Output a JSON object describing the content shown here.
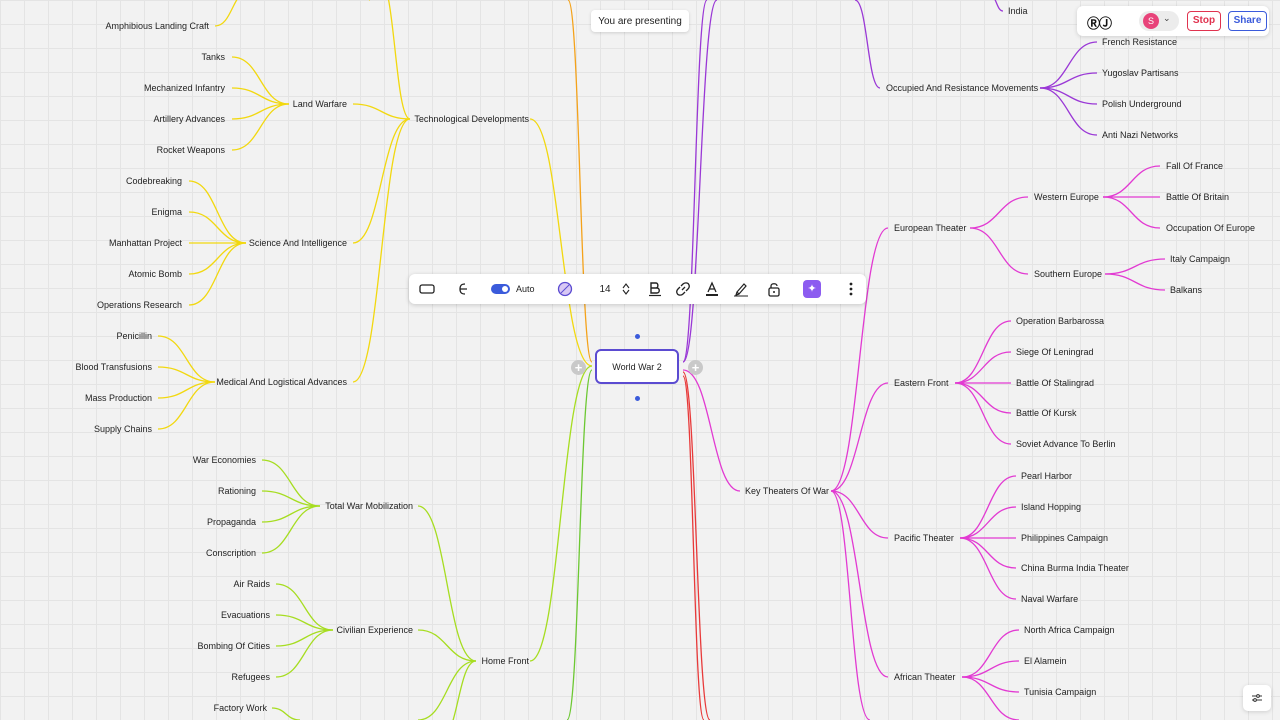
{
  "presenting": {
    "label": "You are presenting"
  },
  "header": {
    "logo": "ⓇⒿ",
    "avatar_initial": "S",
    "stop_label": "Stop",
    "share_label": "Share"
  },
  "toolbar": {
    "auto_label": "Auto",
    "font_size": "14"
  },
  "colors": {
    "accent": "#3b5bdb",
    "root_border": "#5b4bd1",
    "yellow": "#f2d80f",
    "lime": "#a6dd20",
    "green": "#6cc832",
    "orange": "#f4a21a",
    "purple": "#9a38d6",
    "magenta": "#e23ad2",
    "red": "#e83a3a"
  },
  "mindmap": {
    "root": "World War 2",
    "nodes": {
      "amphibious": "Amphibious Landing Craft",
      "tech": "Technological Developments",
      "land": "Land Warfare",
      "tanks": "Tanks",
      "mech": "Mechanized Infantry",
      "artillery": "Artillery Advances",
      "rocket": "Rocket Weapons",
      "science": "Science And Intelligence",
      "codebreaking": "Codebreaking",
      "enigma": "Enigma",
      "manhattan": "Manhattan Project",
      "atomic": "Atomic Bomb",
      "opsresearch": "Operations Research",
      "medical": "Medical And Logistical Advances",
      "penicillin": "Penicillin",
      "blood": "Blood Transfusions",
      "mass": "Mass Production",
      "supply": "Supply Chains",
      "homefront": "Home Front",
      "totalwar": "Total War Mobilization",
      "wareco": "War Economies",
      "rationing": "Rationing",
      "propaganda": "Propaganda",
      "conscription": "Conscription",
      "civilian": "Civilian Experience",
      "airraids": "Air Raids",
      "evac": "Evacuations",
      "bombing": "Bombing Of Cities",
      "refugees": "Refugees",
      "factory": "Factory Work",
      "india": "India",
      "occupied": "Occupied And Resistance Movements",
      "french": "French Resistance",
      "yugoslav": "Yugoslav Partisans",
      "polish": "Polish Underground",
      "antinazi": "Anti Nazi Networks",
      "keytheaters": "Key Theaters Of War",
      "european": "European Theater",
      "western": "Western Europe",
      "falloffrance": "Fall Of France",
      "britain": "Battle Of Britain",
      "occupationeurope": "Occupation Of Europe",
      "southern": "Southern Europe",
      "italy": "Italy Campaign",
      "balkans": "Balkans",
      "eastern": "Eastern Front",
      "barbarossa": "Operation Barbarossa",
      "leningrad": "Siege Of Leningrad",
      "stalingrad": "Battle Of Stalingrad",
      "kursk": "Battle Of Kursk",
      "soviet": "Soviet Advance To Berlin",
      "pacific": "Pacific Theater",
      "pearl": "Pearl Harbor",
      "island": "Island Hopping",
      "philippines": "Philippines Campaign",
      "cbi": "China Burma India Theater",
      "naval": "Naval Warfare",
      "african": "African Theater",
      "northafrica": "North Africa Campaign",
      "alamein": "El Alamein",
      "tunisia": "Tunisia Campaign"
    }
  }
}
